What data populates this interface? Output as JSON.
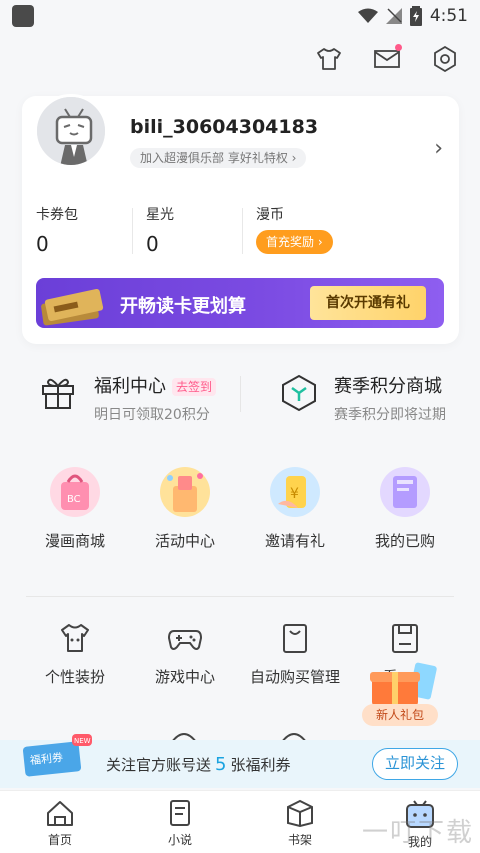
{
  "status_bar": {
    "time": "4:51"
  },
  "top_icons": [
    "tshirt-icon",
    "mail-icon",
    "settings-icon"
  ],
  "profile": {
    "username": "bili_30604304183",
    "club_text": "加入超漫俱乐部 享好礼特权 ›"
  },
  "stats": [
    {
      "label": "卡券包",
      "value": "0"
    },
    {
      "label": "星光",
      "value": "0"
    },
    {
      "label": "漫币",
      "button": "首充奖励 ›"
    }
  ],
  "banner": {
    "text": "开畅读卡更划算",
    "button": "首次开通有礼"
  },
  "welfare": {
    "left": {
      "title": "福利中心",
      "tag": "去签到",
      "sub": "明日可领取20积分"
    },
    "right": {
      "title": "赛季积分商城",
      "sub": "赛季积分即将过期"
    }
  },
  "grid1": [
    {
      "label": "漫画商城",
      "icon": "shopping-bag-icon"
    },
    {
      "label": "活动中心",
      "icon": "party-icon"
    },
    {
      "label": "邀请有礼",
      "icon": "coin-icon"
    },
    {
      "label": "我的已购",
      "icon": "book-icon"
    }
  ],
  "grid2": [
    {
      "label": "个性装扮",
      "icon": "tshirt-icon"
    },
    {
      "label": "游戏中心",
      "icon": "gamepad-icon"
    },
    {
      "label": "自动购买管理",
      "icon": "bag-icon"
    },
    {
      "label": "看...量",
      "icon": "save-icon"
    }
  ],
  "gift": {
    "label": "新人礼包"
  },
  "follow": {
    "badge": "NEW",
    "card_text": "福利券",
    "pre": "关注官方账号送",
    "num": "5",
    "post": "张福利券",
    "button": "立即关注"
  },
  "nav": [
    {
      "label": "首页",
      "icon": "home-icon"
    },
    {
      "label": "小说",
      "icon": "novel-icon"
    },
    {
      "label": "书架",
      "icon": "bookshelf-icon"
    },
    {
      "label": "我的",
      "icon": "profile-icon"
    }
  ],
  "watermark": "一叮下载"
}
